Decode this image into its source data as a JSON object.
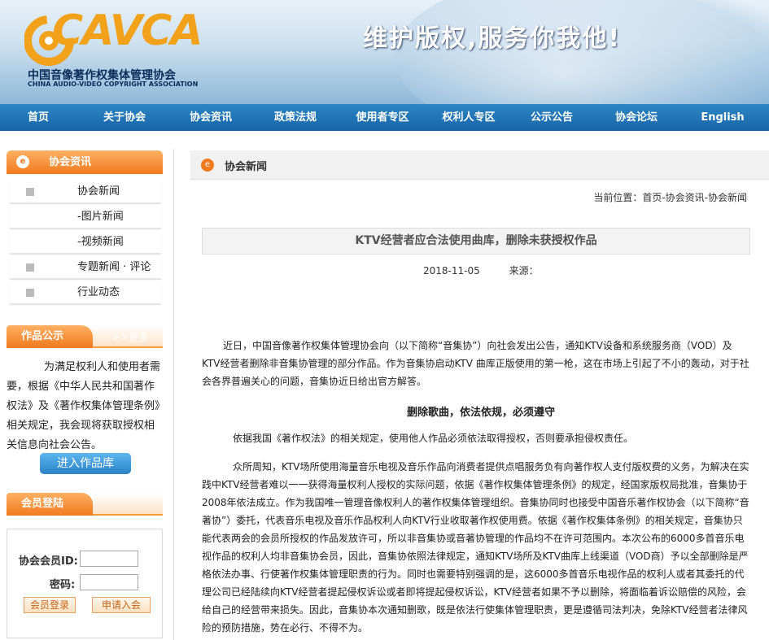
{
  "header": {
    "logo_text": "CAVCA",
    "logo_cn": "中国音像著作权集体管理协会",
    "logo_en": "CHINA AUDIO-VIDEO COPYRIGHT ASSOCIATION",
    "slogan": "维护版权,服务你我他!"
  },
  "nav": [
    "首页",
    "关于协会",
    "协会资讯",
    "政策法规",
    "使用者专区",
    "权利人专区",
    "公示公告",
    "协会论坛",
    "English"
  ],
  "sidebar": {
    "section_title": "协会资讯",
    "items": [
      "协会新闻",
      "-图片新闻",
      "-视频新闻",
      "专题新闻 · 评论",
      "行业动态"
    ],
    "notice_title": "作品公示",
    "more": ">>更多",
    "notice_text": "为满足权利人和使用者需要，根据《中华人民共和国著作权法》及《著作权集体管理条例》相关规定，我会现将获取授权相关信息向社会公告。",
    "enter_button": "进入作品库",
    "login_title": "会员登陆",
    "id_label": "协会会员ID:",
    "pwd_label": "密码:",
    "login_button": "会员登录",
    "apply_button": "申请入会"
  },
  "main": {
    "section_title": "协会新闻",
    "breadcrumb": "当前位置：首页-协会资讯-协会新闻",
    "article_title": "KTV经营者应合法使用曲库，删除未获授权作品",
    "date": "2018-11-05",
    "source_label": "来源：",
    "para1": "近日，中国音像著作权集体管理协会向（以下简称“音集协”）向社会发出公告，通知KTV设备和系统服务商（VOD）及KTV经营者删除非音集协管理的部分作品。作为音集协启动KTV 曲库正版使用的第一枪，这在市场上引起了不小的轰动，对于社会各界普遍关心的问题，音集协近日给出官方解答。",
    "subheading": "删除歌曲，依法依规，必须遵守",
    "para2": "依据我国《著作权法》的相关规定，使用他人作品必须依法取得授权，否则要承担侵权责任。",
    "para3": "众所周知，KTV场所使用海量音乐电视及音乐作品向消费者提供点唱服务负有向著作权人支付版权费的义务，为解决在实践中KTV经营者难以一一获得海量权利人授权的实际问题，依据《著作权集体管理条例》的规定，经国家版权局批准，音集协于2008年依法成立。作为我国唯一管理音像权利人的著作权集体管理组织。音集协同时也接受中国音乐著作权协会（以下简称“音著协”）委托，代表音乐电视及音乐作品权利人向KTV行业收取著作权使用费。依据《著作权集体条例》的相关规定，音集协只能代表两会的会员所授权的作品发放许可，所以非音集协或音著协管理的作品均不在许可范围内。本次公布的6000多首音乐电视作品的权利人均非音集协会员，因此，音集协依照法律规定，通知KTV场所及KTV曲库上线渠道（VOD商）予以全部删除是严格依法办事、行使著作权集体管理职责的行为。同时也需要特别强调的是，这6000多首音乐电视作品的权利人或者其委托的代理公司已经陆续向KTV经营者提起侵权诉讼或者即将提起侵权诉讼，KTV经营者如果不予以删除，将面临着诉讼赔偿的风险，会给自己的经营带来损失。因此，音集协本次通知删歌，既是依法行使集体管理职责，更是遵循司法判决，免除KTV经营者法律风险的预防措施，势在必行、不得不为。"
  }
}
